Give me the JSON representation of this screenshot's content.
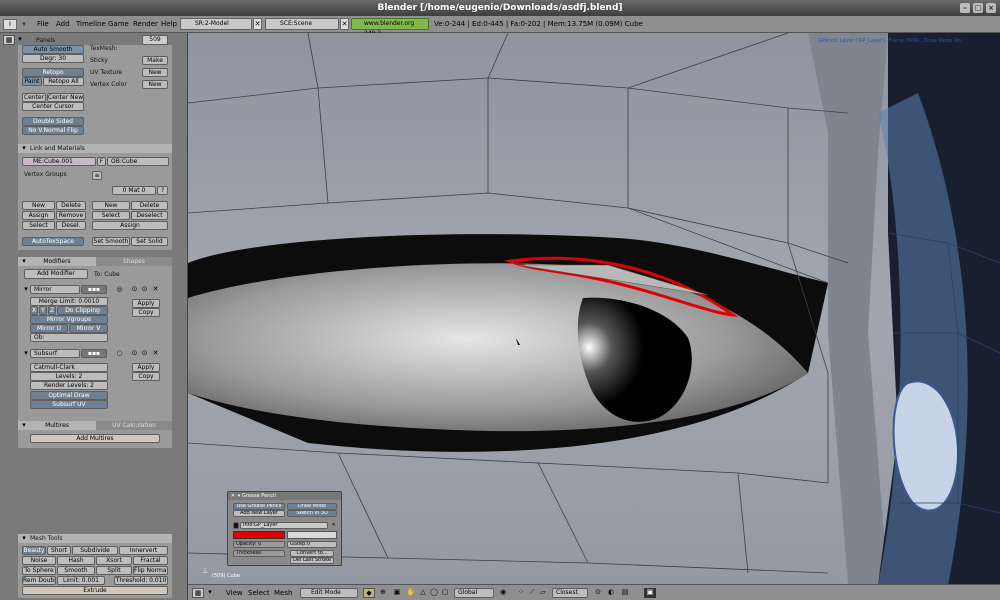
{
  "window": {
    "title": "Blender [/home/eugenio/Downloads/asdfj.blend]"
  },
  "menubar": {
    "menus": [
      "File",
      "Add",
      "Timeline",
      "Game",
      "Render",
      "Help"
    ],
    "screen": "SR:2-Model",
    "scene": "SCE:Scene",
    "url": "www.blender.org 249.2",
    "stats": "Ve:0-244 | Ed:0-445 | Fa:0-202 | Mem:13.75M (0.09M) Cube"
  },
  "panels_header": {
    "title": "Panels",
    "frame": "509"
  },
  "mesh_panel": {
    "auto_smooth": "Auto Smooth",
    "degr": "Degr: 30",
    "retopo": "Retopo",
    "paint": "Paint",
    "retopo_all": "Retopo All",
    "center": "Center",
    "center_new": "Center New",
    "center_cursor": "Center Cursor",
    "double_sided": "Double Sided",
    "no_vnormal_flip": "No V.Normal Flip",
    "texmesh": "TexMesh:",
    "sticky": "Sticky",
    "make": "Make",
    "uv_texture": "UV Texture",
    "new1": "New",
    "vertex_color": "Vertex Color",
    "new2": "New"
  },
  "link_materials": {
    "title": "Link and Materials",
    "me": "ME:Cube.001",
    "f": "F",
    "ob": "OB:Cube",
    "vertex_groups": "Vertex Groups",
    "mat": "0 Mat 0",
    "q": "?",
    "new_l": "New",
    "delete_l": "Delete",
    "assign_l": "Assign",
    "remove_l": "Remove",
    "select_l": "Select",
    "desel_l": "Desel.",
    "new_r": "New",
    "delete_r": "Delete",
    "select_r": "Select",
    "deselect_r": "Deselect",
    "assign_r": "Assign",
    "autotexspace": "AutoTexSpace",
    "set_smooth": "Set Smooth",
    "set_solid": "Set Solid"
  },
  "modifiers": {
    "tab1": "Modifiers",
    "tab2": "Shapes",
    "add_modifier": "Add Modifier",
    "to": "To: Cube",
    "mirror": "Mirror",
    "merge_limit": "Merge Limit: 0.0010",
    "x": "X",
    "y": "Y",
    "z": "Z",
    "do_clipping": "Do Clipping",
    "mirror_vgroups": "Mirror Vgroups",
    "mirror_u": "Mirror U",
    "mirror_v": "Mirror V",
    "ob": "Ob:",
    "apply1": "Apply",
    "copy1": "Copy",
    "subsurf": "Subsurf",
    "catmull": "Catmull-Clark",
    "levels": "Levels: 2",
    "render_levels": "Render Levels: 2",
    "optimal_draw": "Optimal Draw",
    "subsurf_uv": "Subsurf UV",
    "apply2": "Apply",
    "copy2": "Copy"
  },
  "multires": {
    "tab1": "Multires",
    "tab2": "UV Calculation",
    "add": "Add Multires"
  },
  "mesh_tools": {
    "title": "Mesh Tools",
    "beauty": "Beauty",
    "short": "Short",
    "subdivide": "Subdivide",
    "innervert": "Innervert",
    "noise": "Noise",
    "hash": "Hash",
    "xsort": "Xsort",
    "fractal": "Fractal",
    "to_sphere": "To Sphere",
    "smooth": "Smooth",
    "split": "Split",
    "flip_normal": "Flip Normal",
    "rem_doubl": "Rem Doubl",
    "limit": "Limit: 0.001",
    "threshold": "Threshold: 0.010",
    "extrude": "Extrude"
  },
  "viewport": {
    "gpencil_info": "GPencil: Layer ('GP_Layer'), Frame (509) , Draw Mode On",
    "object_label": "(509) Cube"
  },
  "grease_pencil": {
    "title": "Grease Pencil",
    "use": "Use Grease Pencil",
    "draw_mode": "Draw Mode",
    "add_layer": "Add New Layer",
    "sketch3d": "Sketch in 3D",
    "info": "Info:GP_Layer",
    "opacity": "Opacity: 0",
    "gstep": "GStep:0",
    "thickness": "Thickness:",
    "convert": "Convert to...",
    "del_last": "Del Last Stroke"
  },
  "bottombar": {
    "view": "View",
    "select": "Select",
    "mesh": "Mesh",
    "mode": "Edit Mode",
    "orientation": "Global",
    "snap": "Closest"
  }
}
